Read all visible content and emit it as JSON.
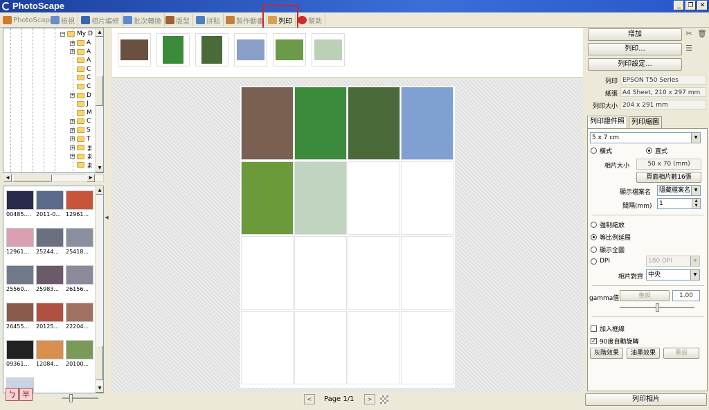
{
  "app": {
    "title": "PhotoScape"
  },
  "window_controls": {
    "minimize": "_",
    "restore": "❐",
    "close": "✕"
  },
  "menu_tabs": [
    {
      "label": "PhotoScape",
      "icon": "photoscape-icon",
      "color": "#d07a2a"
    },
    {
      "label": "檢視",
      "icon": "viewer-icon",
      "color": "#6a8cc7"
    },
    {
      "label": "相片編修",
      "icon": "editor-icon",
      "color": "#3a66b0"
    },
    {
      "label": "批次轉換",
      "icon": "batch-icon",
      "color": "#5b8ad0"
    },
    {
      "label": "版型",
      "icon": "page-icon",
      "color": "#a06030"
    },
    {
      "label": "拼貼",
      "icon": "combine-icon",
      "color": "#4a7fc2"
    },
    {
      "label": "製作動畫",
      "icon": "gif-icon",
      "color": "#c08040"
    },
    {
      "label": "列印",
      "icon": "print-icon",
      "color": "#d8a050"
    },
    {
      "label": "幫助",
      "icon": "help-icon",
      "color": "#d02a2a"
    }
  ],
  "tree": {
    "root_label": "My D",
    "items": [
      "A",
      "A",
      "A",
      "C",
      "C",
      "C",
      "D",
      "J",
      "M",
      "C",
      "S",
      "T",
      "ま",
      "ま",
      "ま"
    ]
  },
  "thumbnails": [
    {
      "caption": "00485....",
      "color": "#2a2a4a"
    },
    {
      "caption": "2011-0...",
      "color": "#5a6a8a"
    },
    {
      "caption": "12961...",
      "color": "#c8553a"
    },
    {
      "caption": "12961...",
      "color": "#d8a0b0"
    },
    {
      "caption": "25244...",
      "color": "#6a7080"
    },
    {
      "caption": "25418...",
      "color": "#8a90a0"
    },
    {
      "caption": "25560...",
      "color": "#707a8a"
    },
    {
      "caption": "25983...",
      "color": "#6a5a6a"
    },
    {
      "caption": "26156...",
      "color": "#8a8a9a"
    },
    {
      "caption": "26455...",
      "color": "#8a5a4a"
    },
    {
      "caption": "20125...",
      "color": "#b05040"
    },
    {
      "caption": "22204...",
      "color": "#a07060"
    },
    {
      "caption": "09361...",
      "color": "#222222"
    },
    {
      "caption": "12084...",
      "color": "#d89050"
    },
    {
      "caption": "20100...",
      "color": "#7a9a5a"
    }
  ],
  "ime": {
    "char1": "ㄅ",
    "char2": "半"
  },
  "filmstrip": [
    {
      "color": "#6a5040",
      "tall": false
    },
    {
      "color": "#3a8a3a",
      "tall": true
    },
    {
      "color": "#4a6a3a",
      "tall": true
    },
    {
      "color": "#8aa0c8",
      "tall": false
    },
    {
      "color": "#6a9a4a",
      "tall": false
    },
    {
      "color": "#bcd0b8",
      "tall": false
    }
  ],
  "print_sheet": [
    {
      "color": "#7a6050",
      "empty": false
    },
    {
      "color": "#3c8a3c",
      "empty": false
    },
    {
      "color": "#4a6a3a",
      "empty": false
    },
    {
      "color": "#7fa0d0",
      "empty": false
    },
    {
      "color": "#6a9a3a",
      "empty": false
    },
    {
      "color": "#c0d4c0",
      "empty": false
    },
    {
      "color": "",
      "empty": true
    },
    {
      "color": "",
      "empty": true
    },
    {
      "color": "",
      "empty": true
    },
    {
      "color": "",
      "empty": true
    },
    {
      "color": "",
      "empty": true
    },
    {
      "color": "",
      "empty": true
    },
    {
      "color": "",
      "empty": true
    },
    {
      "color": "",
      "empty": true
    },
    {
      "color": "",
      "empty": true
    },
    {
      "color": "",
      "empty": true
    }
  ],
  "pager": {
    "prev": "<",
    "label": "Page 1/1",
    "next": ">"
  },
  "right": {
    "add_button": "增加",
    "print_button": "列印...",
    "print_setup_button": "列印設定...",
    "info": [
      {
        "label": "列印",
        "value": "EPSON T50 Series"
      },
      {
        "label": "紙張",
        "value": "A4 Sheet, 210 x 297 mm"
      },
      {
        "label": "列印大小",
        "value": "204 x 291 mm"
      }
    ],
    "tabs": [
      "列印證件照",
      "列印縮圖"
    ],
    "size_select": "5 x 7 cm",
    "orientation": {
      "landscape": "橫式",
      "portrait": "直式",
      "selected": "portrait"
    },
    "photo_size_label": "相片大小",
    "photo_size_value": "50 x 70 (mm)",
    "photos_per_page": "頁面相片數16張",
    "filename_label": "顯示檔案名",
    "filename_select": "隱藏檔案名",
    "spacing_label": "間隔(mm)",
    "spacing_value": "1",
    "scale_options": [
      {
        "label": "強制縮放",
        "on": false
      },
      {
        "label": "等比例延展",
        "on": true
      },
      {
        "label": "顯示全圖",
        "on": false
      }
    ],
    "dpi_label": "DPI",
    "dpi_select": "180 DPI",
    "align_label": "相片對齊",
    "align_select": "中央",
    "gamma_label": "gamma值",
    "gamma_reset": "重設",
    "gamma_value": "1.00",
    "gamma_level": 0.5,
    "add_border_label": "加入框線",
    "add_border_checked": false,
    "auto_rotate_label": "90度自動旋轉",
    "auto_rotate_checked": true,
    "gray_button": "灰階效果",
    "oil_button": "油墨效果",
    "reset_button": "重設",
    "print_photo_button": "列印相片",
    "check_mark": "✓"
  }
}
